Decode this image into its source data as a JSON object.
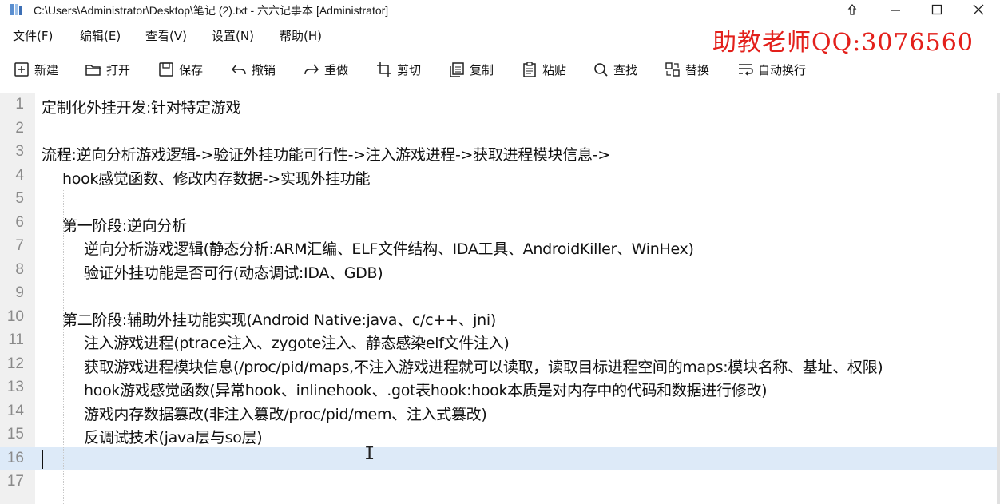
{
  "window": {
    "title": "C:\\Users\\Administrator\\Desktop\\笔记 (2).txt - 六六记事本 [Administrator]",
    "controls": {
      "pin": "⇪",
      "minimize": "─",
      "maximize": "☐",
      "close": "✕"
    }
  },
  "menu": {
    "items": [
      "文件(F)",
      "编辑(E)",
      "查看(V)",
      "设置(N)",
      "帮助(H)"
    ]
  },
  "watermark": "助教老师QQ:3076560",
  "toolbar": {
    "buttons": [
      {
        "label": "新建",
        "icon": "new-file-icon"
      },
      {
        "label": "打开",
        "icon": "open-folder-icon"
      },
      {
        "label": "保存",
        "icon": "save-icon"
      },
      {
        "label": "撤销",
        "icon": "undo-icon"
      },
      {
        "label": "重做",
        "icon": "redo-icon"
      },
      {
        "label": "剪切",
        "icon": "cut-icon"
      },
      {
        "label": "复制",
        "icon": "copy-icon"
      },
      {
        "label": "粘贴",
        "icon": "paste-icon"
      },
      {
        "label": "查找",
        "icon": "search-icon"
      },
      {
        "label": "替换",
        "icon": "replace-icon"
      },
      {
        "label": "自动换行",
        "icon": "word-wrap-icon"
      }
    ]
  },
  "editor": {
    "current_line": 16,
    "lines": [
      {
        "num": "1",
        "text": "定制化外挂开发:针对特定游戏",
        "indent": 0
      },
      {
        "num": "2",
        "text": "",
        "indent": 0
      },
      {
        "num": "3",
        "text": "流程:逆向分析游戏逻辑->验证外挂功能可行性->注入游戏进程->获取进程模块信息->",
        "indent": 0
      },
      {
        "num": "4",
        "text": "hook感觉函数、修改内存数据->实现外挂功能",
        "indent": 1
      },
      {
        "num": "5",
        "text": "",
        "indent": 0
      },
      {
        "num": "6",
        "text": "第一阶段:逆向分析",
        "indent": 1
      },
      {
        "num": "7",
        "text": "逆向分析游戏逻辑(静态分析:ARM汇编、ELF文件结构、IDA工具、AndroidKiller、WinHex)",
        "indent": 2
      },
      {
        "num": "8",
        "text": "验证外挂功能是否可行(动态调试:IDA、GDB)",
        "indent": 2
      },
      {
        "num": "9",
        "text": "",
        "indent": 0
      },
      {
        "num": "10",
        "text": "第二阶段:辅助外挂功能实现(Android Native:java、c/c++、jni)",
        "indent": 1
      },
      {
        "num": "11",
        "text": "注入游戏进程(ptrace注入、zygote注入、静态感染elf文件注入)",
        "indent": 2
      },
      {
        "num": "12",
        "text": "获取游戏进程模块信息(/proc/pid/maps,不注入游戏进程就可以读取，读取目标进程空间的maps:模块名称、基址、权限)",
        "indent": 2
      },
      {
        "num": "13",
        "text": "hook游戏感觉函数(异常hook、inlinehook、.got表hook:hook本质是对内存中的代码和数据进行修改)",
        "indent": 2
      },
      {
        "num": "14",
        "text": "游戏内存数据篡改(非注入篡改/proc/pid/mem、注入式篡改)",
        "indent": 2
      },
      {
        "num": "15",
        "text": "反调试技术(java层与so层)",
        "indent": 2
      },
      {
        "num": "16",
        "text": "",
        "indent": 0
      },
      {
        "num": "17",
        "text": "",
        "indent": 0
      }
    ]
  }
}
